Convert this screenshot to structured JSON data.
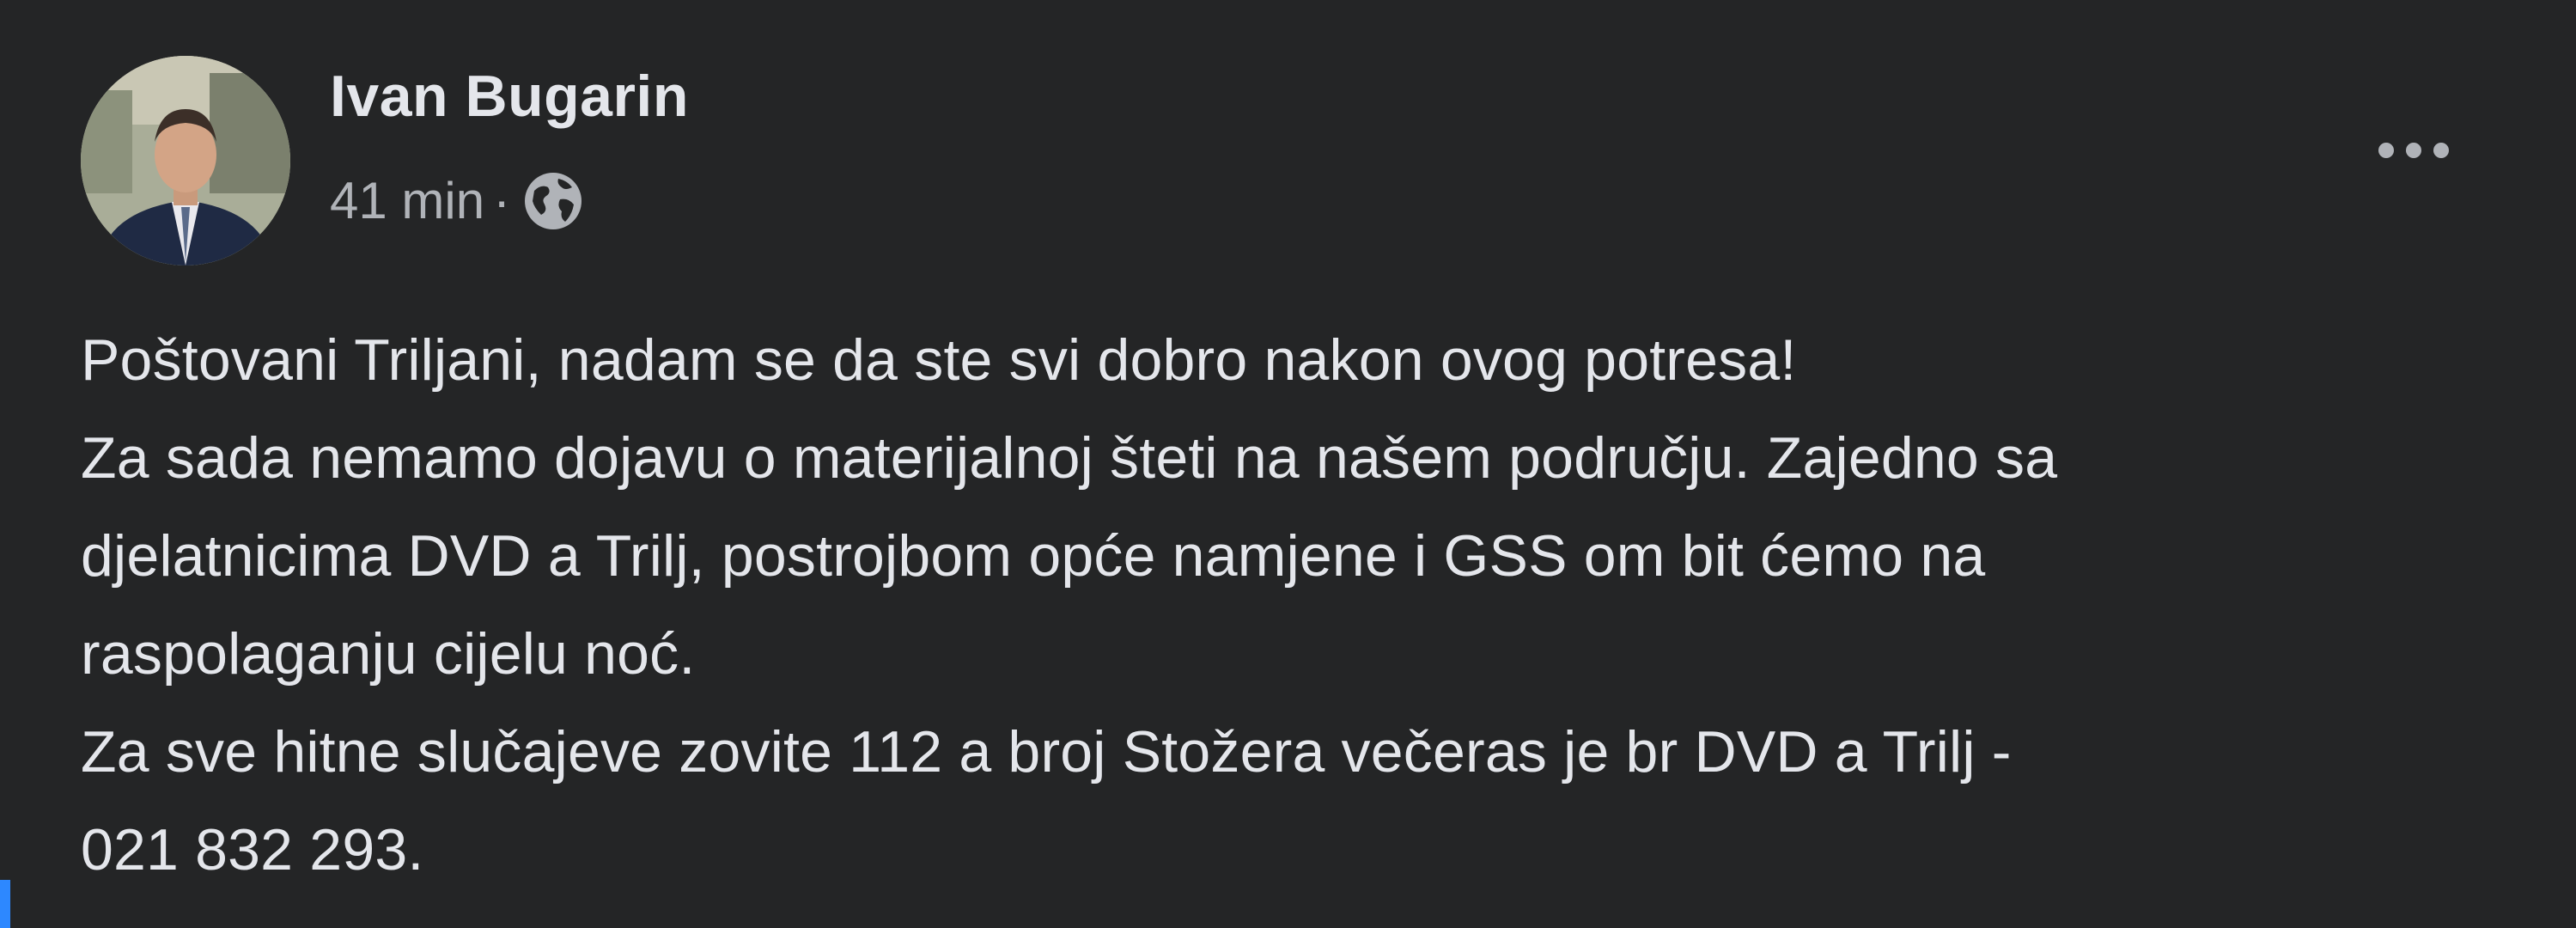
{
  "post": {
    "author": "Ivan Bugarin",
    "time": "41 min",
    "separator": "·",
    "audience_icon": "globe-icon",
    "more_icon": "more-options-icon",
    "body_lines": [
      "Poštovani Triljani, nadam se da ste svi dobro nakon ovog potresa!",
      "Za sada nemamo dojavu o materijalnoj šteti na našem području. Zajedno sa",
      "djelatnicima DVD a Trilj, postrojbom opće namjene i GSS om bit ćemo na",
      "raspolaganju cijelu noć.",
      "Za sve hitne slučajeve zovite 112 a broj Stožera večeras je br DVD a Trilj -",
      "021 832 293."
    ]
  },
  "colors": {
    "background": "#242526",
    "primary_text": "#e4e6eb",
    "secondary_text": "#b0b3b8",
    "accent": "#2d88ff"
  }
}
